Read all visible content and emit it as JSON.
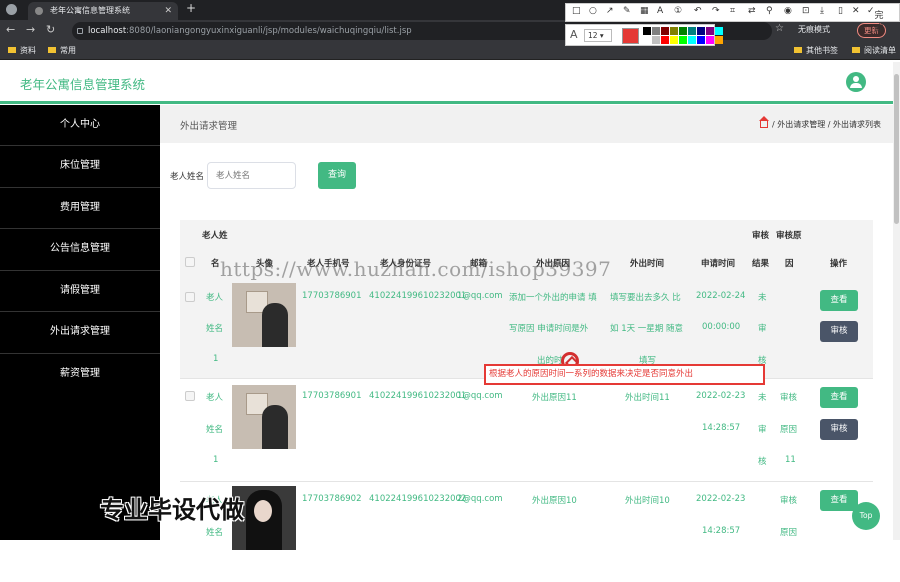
{
  "browser": {
    "tab_title": "老年公寓信息管理系统",
    "url_host": "localhost",
    "url_path": ":8080/laoniangongyuxinxiguanli/jsp/modules/waichuqingqiu/list.jsp",
    "incognito_label": "无痕模式",
    "update_label": "更新",
    "bookmarks": [
      "资料",
      "常用",
      "其他书签",
      "阅读清单"
    ]
  },
  "snip_tool": {
    "done_label": "完成",
    "font_size": "12",
    "colors": [
      "#000000",
      "#808080",
      "#800000",
      "#808000",
      "#008000",
      "#008080",
      "#000080",
      "#800080",
      "#00ffff",
      "#ffffff",
      "#c0c0c0",
      "#ff0000",
      "#ffff00",
      "#00ff00",
      "#00ffff",
      "#0000ff",
      "#ff00ff",
      "#ffa500"
    ]
  },
  "app": {
    "title": "老年公寓信息管理系统",
    "sidebar": [
      "个人中心",
      "床位管理",
      "费用管理",
      "公告信息管理",
      "请假管理",
      "外出请求管理",
      "薪资管理"
    ]
  },
  "page": {
    "heading": "外出请求管理",
    "breadcrumb": "/ 外出请求管理 / 外出请求列表",
    "search": {
      "label": "老人姓名",
      "placeholder": "老人姓名",
      "button": "查询"
    }
  },
  "table": {
    "headers": {
      "name_top": "老人姓",
      "name_bottom": "名",
      "avatar": "头像",
      "phone": "老人手机号",
      "idcard": "老人身份证号",
      "email": "邮箱",
      "reason": "外出原因",
      "out_time": "外出时间",
      "apply_time": "申请时间",
      "audit_top": "审核",
      "audit_bottom": "结果",
      "audit_reason_top": "审核原",
      "audit_reason_bottom": "因",
      "actions": "操作"
    },
    "rows": [
      {
        "name": [
          "老人",
          "姓名",
          "1"
        ],
        "phone": "17703786901",
        "idcard": "410224199610232001",
        "email": "1@qq.com",
        "reason": [
          "添加一个外出的申请 填",
          "写原因 申请时间是外",
          "出的时"
        ],
        "out_time": [
          "填写要出去多久 比",
          "如 1天 一星期 随意",
          "填写"
        ],
        "apply_time": [
          "2022-02-24",
          "00:00:00"
        ],
        "audit": [
          "未",
          "审",
          "核"
        ],
        "audit_reason": [
          "",
          ""
        ]
      },
      {
        "name": [
          "老人",
          "姓名",
          "1"
        ],
        "phone": "17703786901",
        "idcard": "410224199610232001",
        "email": "1@qq.com",
        "reason": [
          "外出原因11"
        ],
        "out_time": [
          "外出时间11"
        ],
        "apply_time": [
          "2022-02-23",
          "14:28:57"
        ],
        "audit": [
          "未",
          "审",
          "核"
        ],
        "audit_reason": [
          "审核",
          "原因",
          "11"
        ]
      },
      {
        "name": [
          "老人",
          "姓名"
        ],
        "phone": "17703786902",
        "idcard": "410224199610232002",
        "email": "2@qq.com",
        "reason": [
          "外出原因10"
        ],
        "out_time": [
          "外出时间10"
        ],
        "apply_time": [
          "2022-02-23",
          "14:28:57"
        ],
        "audit": [],
        "audit_reason": [
          "审核",
          "原因"
        ]
      }
    ],
    "view_label": "查看",
    "audit_label": "审核"
  },
  "annotation": "根据老人的原因时间一系列的数据来决定是否同意外出",
  "watermark": "https://www.huzhan.com/ishop39397",
  "overlay_caption": "专业毕设代做",
  "top_button": "Top"
}
